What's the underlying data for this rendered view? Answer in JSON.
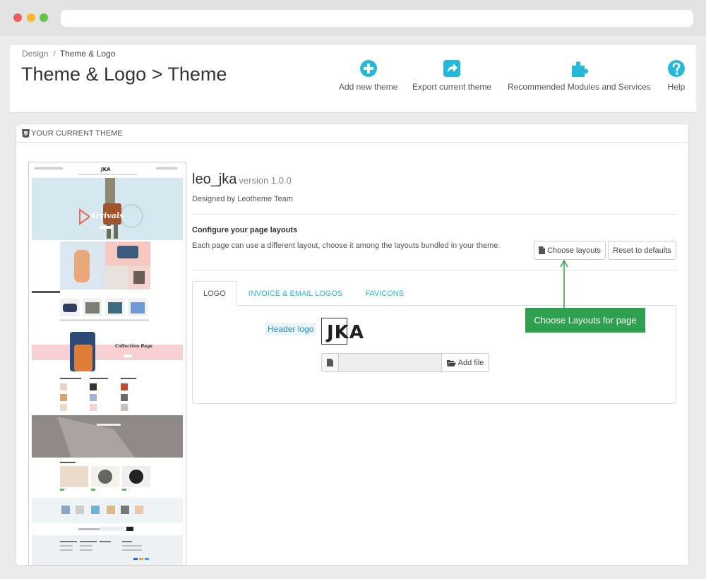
{
  "breadcrumb": {
    "parent": "Design",
    "separator": "/",
    "current": "Theme & Logo"
  },
  "page_title": "Theme & Logo > Theme",
  "toolbar": {
    "add_theme": "Add new theme",
    "export_theme": "Export current theme",
    "recommended": "Recommended Modules and Services",
    "help": "Help"
  },
  "panel": {
    "heading": "YOUR CURRENT THEME"
  },
  "theme": {
    "name": "leo_jka",
    "version": "version 1.0.0",
    "designer": "Designed by Leotheme Team"
  },
  "preview": {
    "logo": "JKA",
    "banner_text": "Arrivals",
    "collection_text": "Collection Bags"
  },
  "layouts": {
    "title": "Configure your page layouts",
    "description": "Each page can use a different layout, choose it among the layouts bundled in your theme.",
    "choose_button": "Choose layouts",
    "reset_button": "Reset to defaults"
  },
  "tabs": [
    {
      "label": "LOGO",
      "active": true
    },
    {
      "label": "INVOICE & EMAIL LOGOS",
      "active": false
    },
    {
      "label": "FAVICONS",
      "active": false
    }
  ],
  "logo_tab": {
    "header_logo_label": "Header logo",
    "logo_text": "JKA",
    "add_file_button": "Add file"
  },
  "annotation": {
    "text": "Choose Layouts for page"
  },
  "colors": {
    "accent": "#25b9d7",
    "annotation": "#2fa04f",
    "background": "#ececec"
  }
}
